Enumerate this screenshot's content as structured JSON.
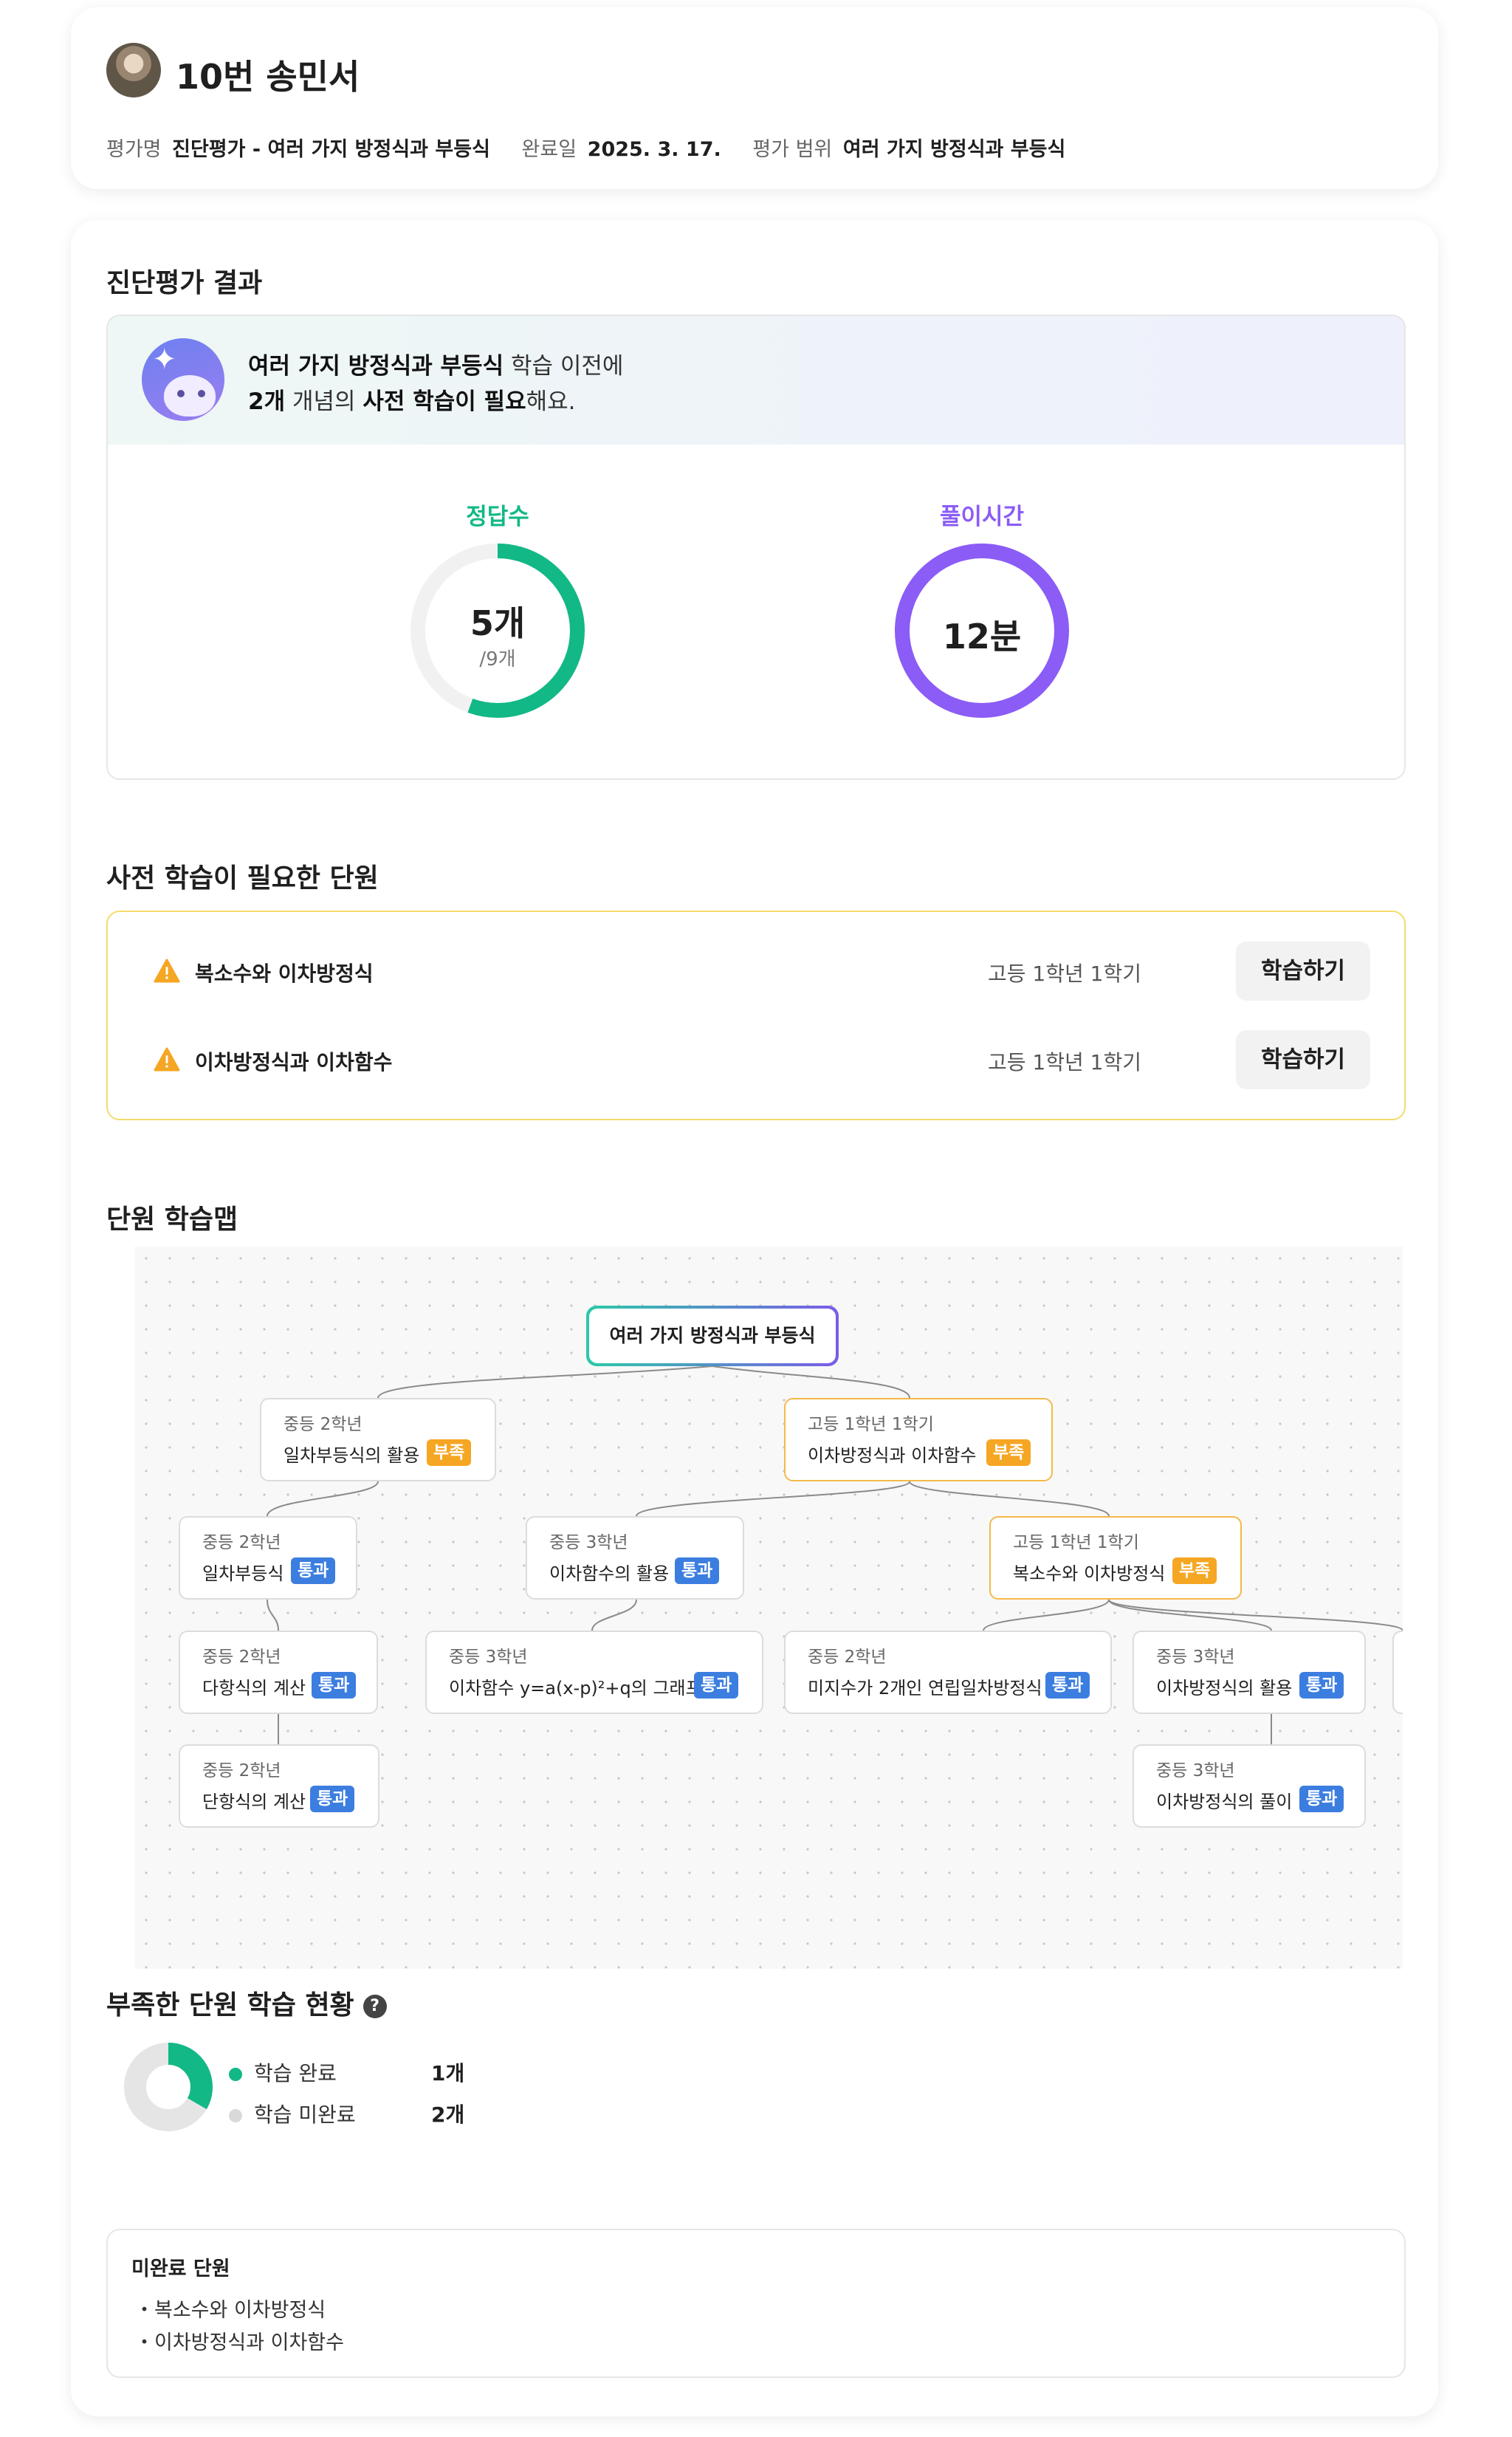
{
  "student": {
    "name": "10번 송민서"
  },
  "meta": {
    "eval_name_label": "평가명",
    "eval_name": "진단평가 - 여러 가지 방정식과 부등식",
    "completed_label": "완료일",
    "completed_date": "2025. 3. 17.",
    "range_label": "평가 범위",
    "range_value": "여러 가지 방정식과 부등식"
  },
  "result": {
    "section_title": "진단평가 결과",
    "banner_line1_bold": "여러 가지 방정식과 부등식",
    "banner_line1_rest": " 학습 이전에",
    "banner_line2_count": "2개",
    "banner_line2_mid": " 개념의 ",
    "banner_line2_bold": "사전 학습이 필요",
    "banner_line2_end": "해요.",
    "correct_label": "정답수",
    "correct_value": "5개",
    "correct_total": "/9개",
    "correct_fraction": 0.5556,
    "time_label": "풀이시간",
    "time_value": "12분",
    "colors": {
      "correct": "#12b886",
      "time": "#8b5cf6",
      "track": "#f1f1f1"
    }
  },
  "prerequisites": {
    "section_title": "사전 학습이 필요한 단원",
    "items": [
      {
        "name": "복소수와 이차방정식",
        "grade": "고등 1학년 1학기",
        "button": "학습하기"
      },
      {
        "name": "이차방정식과 이차함수",
        "grade": "고등 1학년 1학기",
        "button": "학습하기"
      }
    ]
  },
  "learning_map": {
    "section_title": "단원 학습맵",
    "root": "여러 가지 방정식과 부등식",
    "nodes": [
      {
        "grade": "중등 2학년",
        "title": "일차부등식의 활용",
        "status": "부족"
      },
      {
        "grade": "고등 1학년 1학기",
        "title": "이차방정식과 이차함수",
        "status": "부족"
      },
      {
        "grade": "중등 2학년",
        "title": "일차부등식",
        "status": "통과"
      },
      {
        "grade": "중등 3학년",
        "title": "이차함수의 활용",
        "status": "통과"
      },
      {
        "grade": "고등 1학년 1학기",
        "title": "복소수와 이차방정식",
        "status": "부족"
      },
      {
        "grade": "중등 2학년",
        "title": "다항식의 계산",
        "status": "통과"
      },
      {
        "grade": "중등 3학년",
        "title": "이차함수 y=a(x-p)²+q의 그래프",
        "status": "통과"
      },
      {
        "grade": "중등 2학년",
        "title": "미지수가 2개인 연립일차방정식",
        "status": "통과"
      },
      {
        "grade": "중등 3학년",
        "title": "이차방정식의 활용",
        "status": "통과"
      },
      {
        "grade": "중등 2학년",
        "title": "단항식의 계산",
        "status": "통과"
      },
      {
        "grade": "중등 3학년",
        "title": "이차방정식의 풀이",
        "status": "통과"
      }
    ]
  },
  "weak_units": {
    "section_title": "부족한 단원 학습 현황",
    "done_label": "학습 완료",
    "done_count": "1개",
    "undone_label": "학습 미완료",
    "undone_count": "2개",
    "done_fraction": 0.3333,
    "incomplete_title": "미완료 단원",
    "incomplete_items": [
      "복소수와 이차방정식",
      "이차방정식과 이차함수"
    ],
    "colors": {
      "done": "#12b886",
      "undone": "#e5e5e5"
    }
  }
}
